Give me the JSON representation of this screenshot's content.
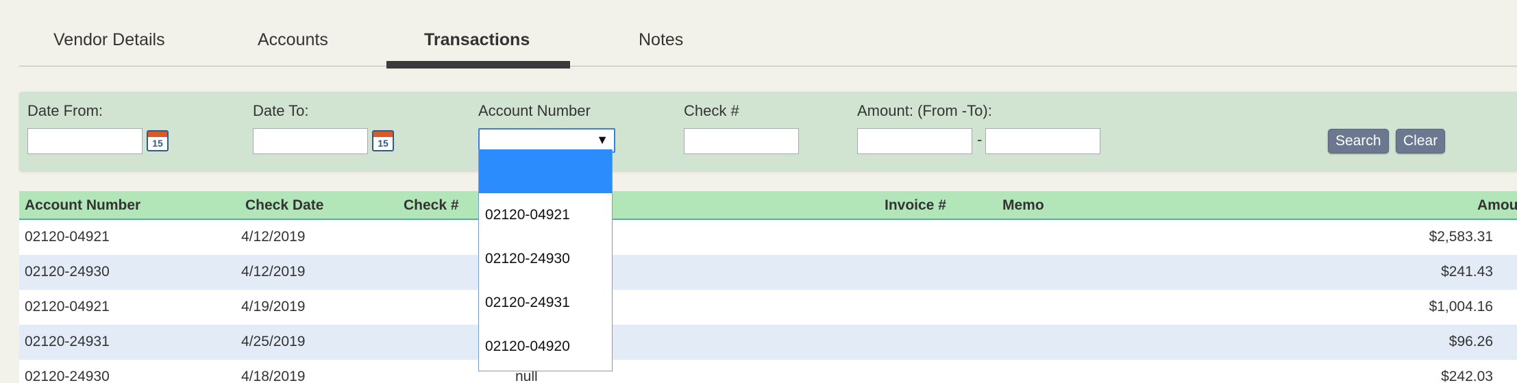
{
  "tabs": [
    {
      "label": "Vendor Details"
    },
    {
      "label": "Accounts"
    },
    {
      "label": "Transactions",
      "active": true
    },
    {
      "label": "Notes"
    }
  ],
  "filters": {
    "date_from_label": "Date From:",
    "date_to_label": "Date To:",
    "account_number_label": "Account Number",
    "check_label": "Check #",
    "amount_label": "Amount: (From -To):",
    "amount_separator": "-",
    "calendar_day": "15",
    "date_from_value": "",
    "date_to_value": "",
    "check_value": "",
    "amount_from_value": "",
    "amount_to_value": "",
    "account_selected": ""
  },
  "buttons": {
    "search_label": "Search",
    "clear_label": "Clear"
  },
  "table": {
    "columns": {
      "account_number": "Account Number",
      "check_date": "Check Date",
      "check_no": "Check #",
      "invoice_no": "Invoice #",
      "memo": "Memo",
      "amount": "Amou"
    },
    "rows": [
      {
        "account": "02120-04921",
        "date": "4/12/2019",
        "check": "",
        "amount": "$2,583.31"
      },
      {
        "account": "02120-24930",
        "date": "4/12/2019",
        "check": "",
        "amount": "$241.43"
      },
      {
        "account": "02120-04921",
        "date": "4/19/2019",
        "check": "",
        "amount": "$1,004.16"
      },
      {
        "account": "02120-24931",
        "date": "4/25/2019",
        "check": "",
        "amount": "$96.26"
      },
      {
        "account": "02120-24930",
        "date": "4/18/2019",
        "check": "null",
        "amount": "$242.03"
      }
    ]
  },
  "dropdown": {
    "options": [
      "",
      "02120-04921",
      "02120-24930",
      "02120-24931",
      "02120-04920"
    ]
  },
  "colors": {
    "filter_bg": "#d1e4d2",
    "header_bg": "#b2e6b8",
    "alt_row_bg": "#e3ebf7",
    "selected_option": "#2b8cfd",
    "button_bg": "#6b7890"
  }
}
